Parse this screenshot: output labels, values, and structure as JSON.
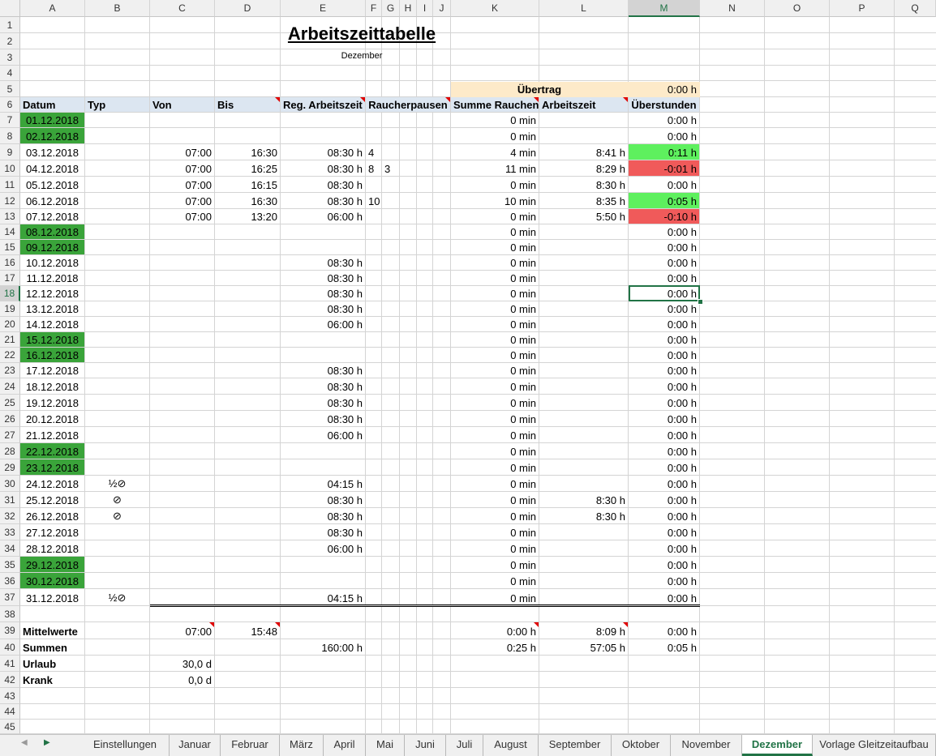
{
  "columns": [
    "A",
    "B",
    "C",
    "D",
    "E",
    "F",
    "G",
    "H",
    "I",
    "J",
    "K",
    "L",
    "M",
    "N",
    "O",
    "P",
    "Q"
  ],
  "selected_column": "M",
  "selected_row": 18,
  "title": "Arbeitszeittabelle",
  "subtitle": "Dezember",
  "carryover": {
    "label": "Übertrag",
    "value": "0:00 h"
  },
  "headers": {
    "datum": "Datum",
    "typ": "Typ",
    "von": "Von",
    "bis": "Bis",
    "reg": "Reg. Arbeitszeit",
    "rauch": "Raucherpausen",
    "summe": "Summe Rauchen",
    "arbeit": "Arbeitszeit",
    "ueber": "Überstunden"
  },
  "days": [
    {
      "date": "01.12.2018",
      "weekend": true,
      "typ": "",
      "von": "",
      "bis": "",
      "reg": "",
      "p1": "",
      "p2": "",
      "sum": "0 min",
      "work": "",
      "over": "0:00 h",
      "status": ""
    },
    {
      "date": "02.12.2018",
      "weekend": true,
      "typ": "",
      "von": "",
      "bis": "",
      "reg": "",
      "p1": "",
      "p2": "",
      "sum": "0 min",
      "work": "",
      "over": "0:00 h",
      "status": ""
    },
    {
      "date": "03.12.2018",
      "weekend": false,
      "typ": "",
      "von": "07:00",
      "bis": "16:30",
      "reg": "08:30 h",
      "p1": "4",
      "p2": "",
      "sum": "4 min",
      "work": "8:41 h",
      "over": "0:11 h",
      "status": "pos"
    },
    {
      "date": "04.12.2018",
      "weekend": false,
      "typ": "",
      "von": "07:00",
      "bis": "16:25",
      "reg": "08:30 h",
      "p1": "8",
      "p2": "3",
      "sum": "11 min",
      "work": "8:29 h",
      "over": "-0:01 h",
      "status": "neg"
    },
    {
      "date": "05.12.2018",
      "weekend": false,
      "typ": "",
      "von": "07:00",
      "bis": "16:15",
      "reg": "08:30 h",
      "p1": "",
      "p2": "",
      "sum": "0 min",
      "work": "8:30 h",
      "over": "0:00 h",
      "status": ""
    },
    {
      "date": "06.12.2018",
      "weekend": false,
      "typ": "",
      "von": "07:00",
      "bis": "16:30",
      "reg": "08:30 h",
      "p1": "10",
      "p2": "",
      "sum": "10 min",
      "work": "8:35 h",
      "over": "0:05 h",
      "status": "pos"
    },
    {
      "date": "07.12.2018",
      "weekend": false,
      "typ": "",
      "von": "07:00",
      "bis": "13:20",
      "reg": "06:00 h",
      "p1": "",
      "p2": "",
      "sum": "0 min",
      "work": "5:50 h",
      "over": "-0:10 h",
      "status": "neg"
    },
    {
      "date": "08.12.2018",
      "weekend": true,
      "typ": "",
      "von": "",
      "bis": "",
      "reg": "",
      "p1": "",
      "p2": "",
      "sum": "0 min",
      "work": "",
      "over": "0:00 h",
      "status": ""
    },
    {
      "date": "09.12.2018",
      "weekend": true,
      "typ": "",
      "von": "",
      "bis": "",
      "reg": "",
      "p1": "",
      "p2": "",
      "sum": "0 min",
      "work": "",
      "over": "0:00 h",
      "status": ""
    },
    {
      "date": "10.12.2018",
      "weekend": false,
      "typ": "",
      "von": "",
      "bis": "",
      "reg": "08:30 h",
      "p1": "",
      "p2": "",
      "sum": "0 min",
      "work": "",
      "over": "0:00 h",
      "status": ""
    },
    {
      "date": "11.12.2018",
      "weekend": false,
      "typ": "",
      "von": "",
      "bis": "",
      "reg": "08:30 h",
      "p1": "",
      "p2": "",
      "sum": "0 min",
      "work": "",
      "over": "0:00 h",
      "status": ""
    },
    {
      "date": "12.12.2018",
      "weekend": false,
      "typ": "",
      "von": "",
      "bis": "",
      "reg": "08:30 h",
      "p1": "",
      "p2": "",
      "sum": "0 min",
      "work": "",
      "over": "0:00 h",
      "status": ""
    },
    {
      "date": "13.12.2018",
      "weekend": false,
      "typ": "",
      "von": "",
      "bis": "",
      "reg": "08:30 h",
      "p1": "",
      "p2": "",
      "sum": "0 min",
      "work": "",
      "over": "0:00 h",
      "status": ""
    },
    {
      "date": "14.12.2018",
      "weekend": false,
      "typ": "",
      "von": "",
      "bis": "",
      "reg": "06:00 h",
      "p1": "",
      "p2": "",
      "sum": "0 min",
      "work": "",
      "over": "0:00 h",
      "status": ""
    },
    {
      "date": "15.12.2018",
      "weekend": true,
      "typ": "",
      "von": "",
      "bis": "",
      "reg": "",
      "p1": "",
      "p2": "",
      "sum": "0 min",
      "work": "",
      "over": "0:00 h",
      "status": ""
    },
    {
      "date": "16.12.2018",
      "weekend": true,
      "typ": "",
      "von": "",
      "bis": "",
      "reg": "",
      "p1": "",
      "p2": "",
      "sum": "0 min",
      "work": "",
      "over": "0:00 h",
      "status": ""
    },
    {
      "date": "17.12.2018",
      "weekend": false,
      "typ": "",
      "von": "",
      "bis": "",
      "reg": "08:30 h",
      "p1": "",
      "p2": "",
      "sum": "0 min",
      "work": "",
      "over": "0:00 h",
      "status": ""
    },
    {
      "date": "18.12.2018",
      "weekend": false,
      "typ": "",
      "von": "",
      "bis": "",
      "reg": "08:30 h",
      "p1": "",
      "p2": "",
      "sum": "0 min",
      "work": "",
      "over": "0:00 h",
      "status": ""
    },
    {
      "date": "19.12.2018",
      "weekend": false,
      "typ": "",
      "von": "",
      "bis": "",
      "reg": "08:30 h",
      "p1": "",
      "p2": "",
      "sum": "0 min",
      "work": "",
      "over": "0:00 h",
      "status": ""
    },
    {
      "date": "20.12.2018",
      "weekend": false,
      "typ": "",
      "von": "",
      "bis": "",
      "reg": "08:30 h",
      "p1": "",
      "p2": "",
      "sum": "0 min",
      "work": "",
      "over": "0:00 h",
      "status": ""
    },
    {
      "date": "21.12.2018",
      "weekend": false,
      "typ": "",
      "von": "",
      "bis": "",
      "reg": "06:00 h",
      "p1": "",
      "p2": "",
      "sum": "0 min",
      "work": "",
      "over": "0:00 h",
      "status": ""
    },
    {
      "date": "22.12.2018",
      "weekend": true,
      "typ": "",
      "von": "",
      "bis": "",
      "reg": "",
      "p1": "",
      "p2": "",
      "sum": "0 min",
      "work": "",
      "over": "0:00 h",
      "status": ""
    },
    {
      "date": "23.12.2018",
      "weekend": true,
      "typ": "",
      "von": "",
      "bis": "",
      "reg": "",
      "p1": "",
      "p2": "",
      "sum": "0 min",
      "work": "",
      "over": "0:00 h",
      "status": ""
    },
    {
      "date": "24.12.2018",
      "weekend": false,
      "typ": "½⊘",
      "von": "",
      "bis": "",
      "reg": "04:15 h",
      "p1": "",
      "p2": "",
      "sum": "0 min",
      "work": "",
      "over": "0:00 h",
      "status": ""
    },
    {
      "date": "25.12.2018",
      "weekend": false,
      "typ": "⊘",
      "von": "",
      "bis": "",
      "reg": "08:30 h",
      "p1": "",
      "p2": "",
      "sum": "0 min",
      "work": "8:30 h",
      "over": "0:00 h",
      "status": ""
    },
    {
      "date": "26.12.2018",
      "weekend": false,
      "typ": "⊘",
      "von": "",
      "bis": "",
      "reg": "08:30 h",
      "p1": "",
      "p2": "",
      "sum": "0 min",
      "work": "8:30 h",
      "over": "0:00 h",
      "status": ""
    },
    {
      "date": "27.12.2018",
      "weekend": false,
      "typ": "",
      "von": "",
      "bis": "",
      "reg": "08:30 h",
      "p1": "",
      "p2": "",
      "sum": "0 min",
      "work": "",
      "over": "0:00 h",
      "status": ""
    },
    {
      "date": "28.12.2018",
      "weekend": false,
      "typ": "",
      "von": "",
      "bis": "",
      "reg": "06:00 h",
      "p1": "",
      "p2": "",
      "sum": "0 min",
      "work": "",
      "over": "0:00 h",
      "status": ""
    },
    {
      "date": "29.12.2018",
      "weekend": true,
      "typ": "",
      "von": "",
      "bis": "",
      "reg": "",
      "p1": "",
      "p2": "",
      "sum": "0 min",
      "work": "",
      "over": "0:00 h",
      "status": ""
    },
    {
      "date": "30.12.2018",
      "weekend": true,
      "typ": "",
      "von": "",
      "bis": "",
      "reg": "",
      "p1": "",
      "p2": "",
      "sum": "0 min",
      "work": "",
      "over": "0:00 h",
      "status": ""
    },
    {
      "date": "31.12.2018",
      "weekend": false,
      "typ": "½⊘",
      "von": "",
      "bis": "",
      "reg": "04:15 h",
      "p1": "",
      "p2": "",
      "sum": "0 min",
      "work": "",
      "over": "0:00 h",
      "status": ""
    }
  ],
  "summary": {
    "avg": {
      "label": "Mittelwerte",
      "von": "07:00",
      "bis": "15:48",
      "sum": "0:00 h",
      "work": "8:09 h",
      "over": "0:00 h"
    },
    "total": {
      "label": "Summen",
      "reg": "160:00 h",
      "sum": "0:25 h",
      "work": "57:05 h",
      "over": "0:05 h"
    },
    "vacation": {
      "label": "Urlaub",
      "value": "30,0 d"
    },
    "sick": {
      "label": "Krank",
      "value": "0,0 d"
    }
  },
  "tabs": [
    "Einstellungen",
    "Januar",
    "Februar",
    "März",
    "April",
    "Mai",
    "Juni",
    "Juli",
    "August",
    "September",
    "Oktober",
    "November",
    "Dezember",
    "Vorlage Gleitzeitaufbau"
  ],
  "active_tab": "Dezember",
  "colors": {
    "weekend": "#3aa43a",
    "positive": "#5ef05e",
    "negative": "#f05a5a",
    "header": "#dce6f1",
    "carryover": "#fdeac9",
    "accent": "#217346"
  }
}
